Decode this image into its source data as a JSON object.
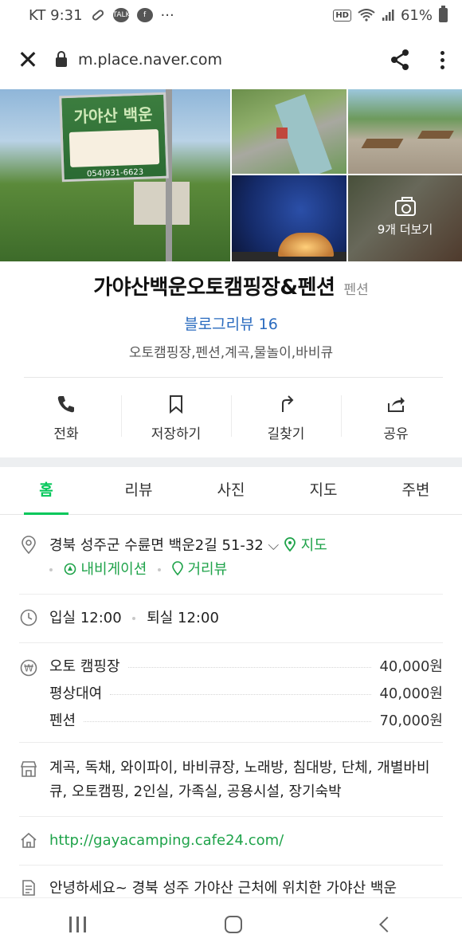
{
  "status_bar": {
    "carrier_time": "KT 9:31",
    "notif_icons": [
      "pill-icon",
      "talk-icon",
      "facebook-icon",
      "more-dots"
    ],
    "talk_label": "TALK",
    "hd_label": "HD",
    "battery": "61%"
  },
  "browser": {
    "url": "m.place.naver.com"
  },
  "photos": {
    "sign_title": "가야산 백운",
    "sign_phone": "054)931-6623",
    "more_label": "9개 더보기"
  },
  "place": {
    "name": "가야산백운오토캠핑장&펜션",
    "category": "펜션",
    "blog_review": "블로그리뷰 16",
    "tags": "오토캠핑장,펜션,계곡,물놀이,바비큐"
  },
  "actions": [
    {
      "label": "전화",
      "icon": "phone-icon"
    },
    {
      "label": "저장하기",
      "icon": "bookmark-icon"
    },
    {
      "label": "길찾기",
      "icon": "directions-icon"
    },
    {
      "label": "공유",
      "icon": "share-icon"
    }
  ],
  "tabs": [
    "홈",
    "리뷰",
    "사진",
    "지도",
    "주변"
  ],
  "active_tab": "홈",
  "info": {
    "address": "경북 성주군 수륜면 백운2길 51-32",
    "map_link": "지도",
    "navigation_link": "내비게이션",
    "street_view_link": "거리뷰",
    "checkin": "입실 12:00",
    "checkout": "퇴실 12:00",
    "prices": [
      {
        "name": "오토 캠핑장",
        "value": "40,000원"
      },
      {
        "name": "평상대여",
        "value": "40,000원"
      },
      {
        "name": "펜션",
        "value": "70,000원"
      }
    ],
    "facilities": "계곡, 독채, 와이파이, 바비큐장, 노래방, 침대방, 단체, 개별바비큐, 오토캠핑, 2인실, 가족실, 공용시설, 장기숙박",
    "website": "http://gayacamping.cafe24.com/",
    "description": "안녕하세요~ 경북 성주 가야산 근처에 위치한 가야산 백운"
  },
  "colors": {
    "accent_green": "#03c75a",
    "link_blue": "#2a6bbf"
  }
}
